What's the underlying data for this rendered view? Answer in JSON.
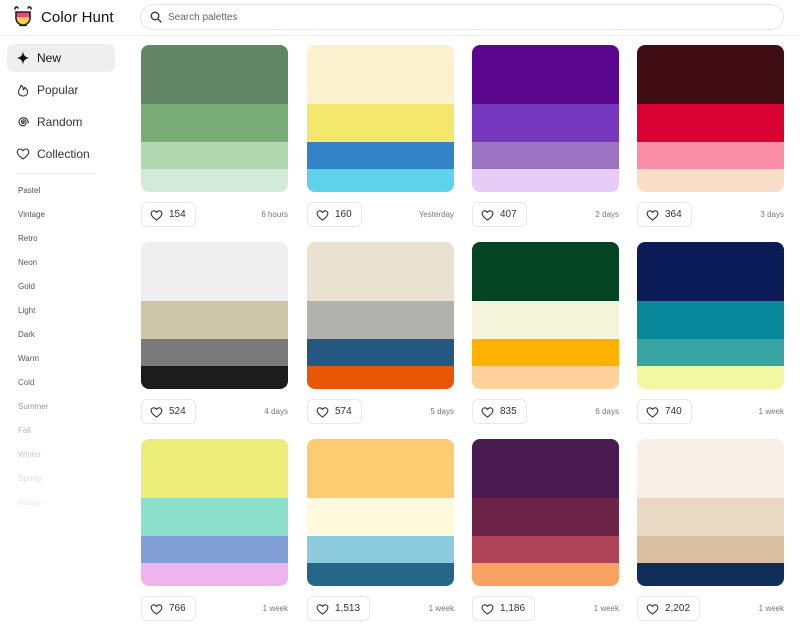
{
  "header": {
    "app_name": "Color Hunt",
    "search_placeholder": "Search palettes"
  },
  "sidebar": {
    "nav": [
      {
        "label": "New",
        "icon": "sparkle-icon",
        "active": true
      },
      {
        "label": "Popular",
        "icon": "flame-icon",
        "active": false
      },
      {
        "label": "Random",
        "icon": "spiral-icon",
        "active": false
      },
      {
        "label": "Collection",
        "icon": "heart-icon",
        "active": false
      }
    ],
    "tags": [
      {
        "label": "Pastel",
        "color": "#555555"
      },
      {
        "label": "Vintage",
        "color": "#555555"
      },
      {
        "label": "Retro",
        "color": "#555555"
      },
      {
        "label": "Neon",
        "color": "#555555"
      },
      {
        "label": "Gold",
        "color": "#555555"
      },
      {
        "label": "Light",
        "color": "#555555"
      },
      {
        "label": "Dark",
        "color": "#555555"
      },
      {
        "label": "Warm",
        "color": "#555555"
      },
      {
        "label": "Cold",
        "color": "#666666"
      },
      {
        "label": "Summer",
        "color": "#999999"
      },
      {
        "label": "Fall",
        "color": "#b8b8b8"
      },
      {
        "label": "Winter",
        "color": "#cccccc"
      },
      {
        "label": "Spring",
        "color": "#dddddd"
      },
      {
        "label": "Happy",
        "color": "#ebebeb"
      }
    ]
  },
  "palettes": [
    {
      "colors": [
        "#628566",
        "#7aac78",
        "#b1d8b1",
        "#d3eadb"
      ],
      "likes": "154",
      "time": "6 hours"
    },
    {
      "colors": [
        "#fcf2cf",
        "#f4e76e",
        "#3383c8",
        "#5cd3ea"
      ],
      "likes": "160",
      "time": "Yesterday"
    },
    {
      "colors": [
        "#5b078d",
        "#7537bd",
        "#9b75c3",
        "#e6ccf6"
      ],
      "likes": "407",
      "time": "2 days"
    },
    {
      "colors": [
        "#400d14",
        "#d90132",
        "#f98ea6",
        "#fadec7"
      ],
      "likes": "364",
      "time": "3 days"
    },
    {
      "colors": [
        "#f0eff0",
        "#cdc7aa",
        "#7a7a7a",
        "#1c1c1c"
      ],
      "likes": "524",
      "time": "4 days"
    },
    {
      "colors": [
        "#eae2d0",
        "#b1b1b0",
        "#255881",
        "#e85706"
      ],
      "likes": "574",
      "time": "5 days"
    },
    {
      "colors": [
        "#044422",
        "#f4f6dc",
        "#ffb100",
        "#ffd19d"
      ],
      "likes": "835",
      "time": "6 days"
    },
    {
      "colors": [
        "#0a1b58",
        "#08869a",
        "#38a4a1",
        "#f1f8a1"
      ],
      "likes": "740",
      "time": "1 week"
    },
    {
      "colors": [
        "#ecec79",
        "#8cdfcb",
        "#819fd4",
        "#efb3ed"
      ],
      "likes": "766",
      "time": "1 week"
    },
    {
      "colors": [
        "#fdcb70",
        "#fefadb",
        "#8ccbdd",
        "#266789"
      ],
      "likes": "1,513",
      "time": "1 week"
    },
    {
      "colors": [
        "#491b52",
        "#6b2346",
        "#ae4358",
        "#f8a262"
      ],
      "likes": "1,186",
      "time": "1 week"
    },
    {
      "colors": [
        "#f8f0e6",
        "#e9d9c4",
        "#d9bfa0",
        "#0f2e59"
      ],
      "likes": "2,202",
      "time": "1 week"
    }
  ]
}
